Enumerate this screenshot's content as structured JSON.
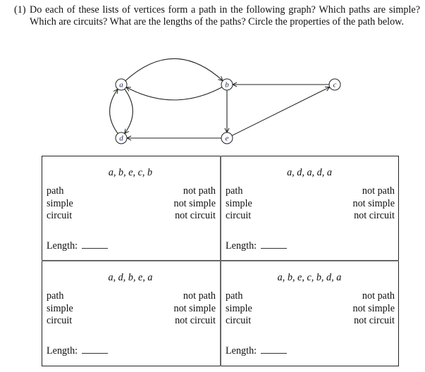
{
  "question": {
    "number": "(1)",
    "text": "Do each of these lists of vertices form a path in the following graph? Which paths are simple? Which are circuits? What are the lengths of the paths? Circle the properties of the path below."
  },
  "graph": {
    "nodes": [
      {
        "id": "a",
        "label": "a"
      },
      {
        "id": "b",
        "label": "b"
      },
      {
        "id": "c",
        "label": "c"
      },
      {
        "id": "d",
        "label": "d"
      },
      {
        "id": "e",
        "label": "e"
      }
    ],
    "edges": [
      {
        "from": "a",
        "to": "b"
      },
      {
        "from": "b",
        "to": "a"
      },
      {
        "from": "a",
        "to": "d"
      },
      {
        "from": "d",
        "to": "a"
      },
      {
        "from": "b",
        "to": "e"
      },
      {
        "from": "e",
        "to": "d"
      },
      {
        "from": "e",
        "to": "c"
      },
      {
        "from": "c",
        "to": "b"
      }
    ]
  },
  "cells": [
    {
      "sequence": "a, b, e, c, b",
      "left": [
        "path",
        "simple",
        "circuit"
      ],
      "right": [
        "not path",
        "not simple",
        "not circuit"
      ],
      "length_label": "Length:"
    },
    {
      "sequence": "a, d, a, d, a",
      "left": [
        "path",
        "simple",
        "circuit"
      ],
      "right": [
        "not path",
        "not simple",
        "not circuit"
      ],
      "length_label": "Length:"
    },
    {
      "sequence": "a, d, b, e, a",
      "left": [
        "path",
        "simple",
        "circuit"
      ],
      "right": [
        "not path",
        "not simple",
        "not circuit"
      ],
      "length_label": "Length:"
    },
    {
      "sequence": "a, b, e, c, b, d, a",
      "left": [
        "path",
        "simple",
        "circuit"
      ],
      "right": [
        "not path",
        "not simple",
        "not circuit"
      ],
      "length_label": "Length:"
    }
  ]
}
